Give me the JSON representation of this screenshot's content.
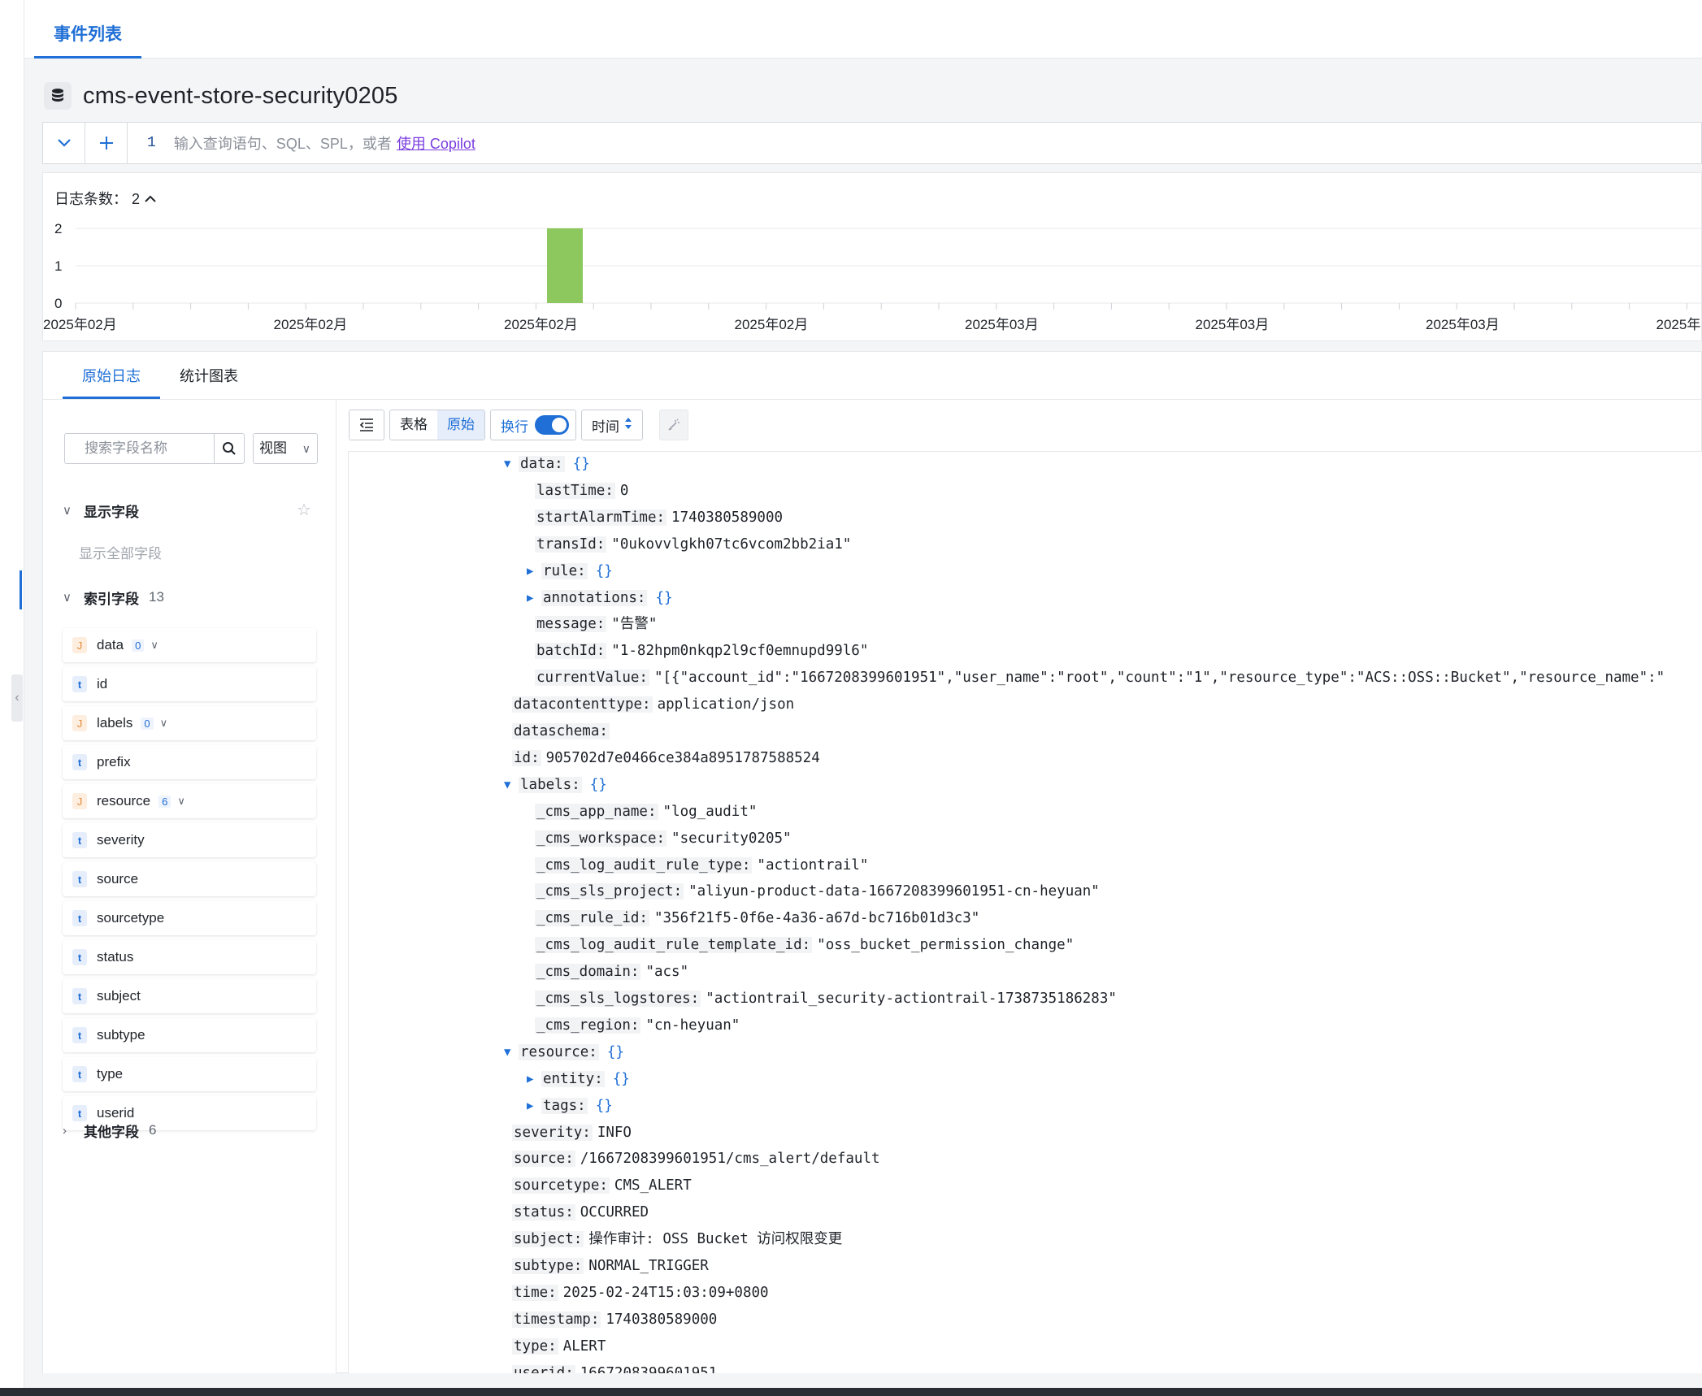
{
  "header": {
    "tab_label": "事件列表"
  },
  "store": {
    "name": "cms-event-store-security0205"
  },
  "query": {
    "line_number": "1",
    "placeholder": "输入查询语句、SQL、SPL，或者",
    "copilot_link": "使用 Copilot"
  },
  "histogram": {
    "log_count_label": "日志条数：",
    "log_count": "2",
    "y_ticks": [
      "2",
      "1",
      "0"
    ],
    "x_ticks": [
      "2025年02月",
      "2025年02月",
      "2025年02月",
      "2025年02月",
      "2025年03月",
      "2025年03月",
      "2025年03月",
      "2025年"
    ],
    "bar_color": "#8cc85e"
  },
  "chart_data": {
    "type": "bar",
    "title": "",
    "xlabel": "",
    "ylabel": "",
    "categories": [
      "2025年02月"
    ],
    "values": [
      2
    ],
    "ylim": [
      0,
      2
    ],
    "grid": true
  },
  "result_tabs": [
    {
      "label": "原始日志"
    },
    {
      "label": "统计图表"
    }
  ],
  "sidebar": {
    "search_placeholder": "搜索字段名称",
    "view_label": "视图",
    "display_fields_title": "显示字段",
    "show_all_label": "显示全部字段",
    "index_fields_title": "索引字段",
    "index_fields_count": "13",
    "other_fields_title": "其他字段",
    "other_fields_count": "6",
    "fields": [
      {
        "type": "J",
        "name": "data",
        "count": "0"
      },
      {
        "type": "t",
        "name": "id"
      },
      {
        "type": "J",
        "name": "labels",
        "count": "0"
      },
      {
        "type": "t",
        "name": "prefix"
      },
      {
        "type": "J",
        "name": "resource",
        "count": "6"
      },
      {
        "type": "t",
        "name": "severity"
      },
      {
        "type": "t",
        "name": "source"
      },
      {
        "type": "t",
        "name": "sourcetype"
      },
      {
        "type": "t",
        "name": "status"
      },
      {
        "type": "t",
        "name": "subject"
      },
      {
        "type": "t",
        "name": "subtype"
      },
      {
        "type": "t",
        "name": "type"
      },
      {
        "type": "t",
        "name": "userid"
      }
    ]
  },
  "toolbar": {
    "table_label": "表格",
    "raw_label": "原始",
    "wrap_label": "换行",
    "time_label": "时间"
  },
  "log": [
    {
      "indent": 0,
      "exp": "open",
      "key": "data:",
      "brace": "{}"
    },
    {
      "indent": 1,
      "key": "lastTime:",
      "value": "0"
    },
    {
      "indent": 1,
      "key": "startAlarmTime:",
      "value": "1740380589000"
    },
    {
      "indent": 1,
      "key": "transId:",
      "value": "\"0ukovvlgkh07tc6vcom2bb2ia1\""
    },
    {
      "indent": 1,
      "exp": "closed",
      "key": "rule:",
      "brace": "{}"
    },
    {
      "indent": 1,
      "exp": "closed",
      "key": "annotations:",
      "brace": "{}"
    },
    {
      "indent": 1,
      "key": "message:",
      "value": "\"告警\""
    },
    {
      "indent": 1,
      "key": "batchId:",
      "value": "\"1-82hpm0nkqp2l9cf0emnupd99l6\""
    },
    {
      "indent": 1,
      "key": "currentValue:",
      "value": "\"[{\"account_id\":\"1667208399601951\",\"user_name\":\"root\",\"count\":\"1\",\"resource_type\":\"ACS::OSS::Bucket\",\"resource_name\":\""
    },
    {
      "indent": 0,
      "key": "datacontenttype:",
      "value": "application/json"
    },
    {
      "indent": 0,
      "key": "dataschema:",
      "value": ""
    },
    {
      "indent": 0,
      "key": "id:",
      "value": "905702d7e0466ce384a8951787588524"
    },
    {
      "indent": 0,
      "exp": "open",
      "key": "labels:",
      "brace": "{}"
    },
    {
      "indent": 1,
      "key": "_cms_app_name:",
      "value": "\"log_audit\""
    },
    {
      "indent": 1,
      "key": "_cms_workspace:",
      "value": "\"security0205\""
    },
    {
      "indent": 1,
      "key": "_cms_log_audit_rule_type:",
      "value": "\"actiontrail\""
    },
    {
      "indent": 1,
      "key": "_cms_sls_project:",
      "value": "\"aliyun-product-data-1667208399601951-cn-heyuan\""
    },
    {
      "indent": 1,
      "key": "_cms_rule_id:",
      "value": "\"356f21f5-0f6e-4a36-a67d-bc716b01d3c3\""
    },
    {
      "indent": 1,
      "key": "_cms_log_audit_rule_template_id:",
      "value": "\"oss_bucket_permission_change\""
    },
    {
      "indent": 1,
      "key": "_cms_domain:",
      "value": "\"acs\""
    },
    {
      "indent": 1,
      "key": "_cms_sls_logstores:",
      "value": "\"actiontrail_security-actiontrail-1738735186283\""
    },
    {
      "indent": 1,
      "key": "_cms_region:",
      "value": "\"cn-heyuan\""
    },
    {
      "indent": 0,
      "exp": "open",
      "key": "resource:",
      "brace": "{}"
    },
    {
      "indent": 1,
      "exp": "closed",
      "key": "entity:",
      "brace": "{}"
    },
    {
      "indent": 1,
      "exp": "closed",
      "key": "tags:",
      "brace": "{}"
    },
    {
      "indent": 0,
      "key": "severity:",
      "value": "INFO"
    },
    {
      "indent": 0,
      "key": "source:",
      "value": "/1667208399601951/cms_alert/default"
    },
    {
      "indent": 0,
      "key": "sourcetype:",
      "value": "CMS_ALERT"
    },
    {
      "indent": 0,
      "key": "status:",
      "value": "OCCURRED"
    },
    {
      "indent": 0,
      "key": "subject:",
      "value": "操作审计: OSS Bucket 访问权限变更"
    },
    {
      "indent": 0,
      "key": "subtype:",
      "value": "NORMAL_TRIGGER"
    },
    {
      "indent": 0,
      "key": "time:",
      "value": "2025-02-24T15:03:09+0800"
    },
    {
      "indent": 0,
      "key": "timestamp:",
      "value": "1740380589000"
    },
    {
      "indent": 0,
      "key": "type:",
      "value": "ALERT"
    },
    {
      "indent": 0,
      "key": "userid:",
      "value": "1667208399601951"
    }
  ]
}
